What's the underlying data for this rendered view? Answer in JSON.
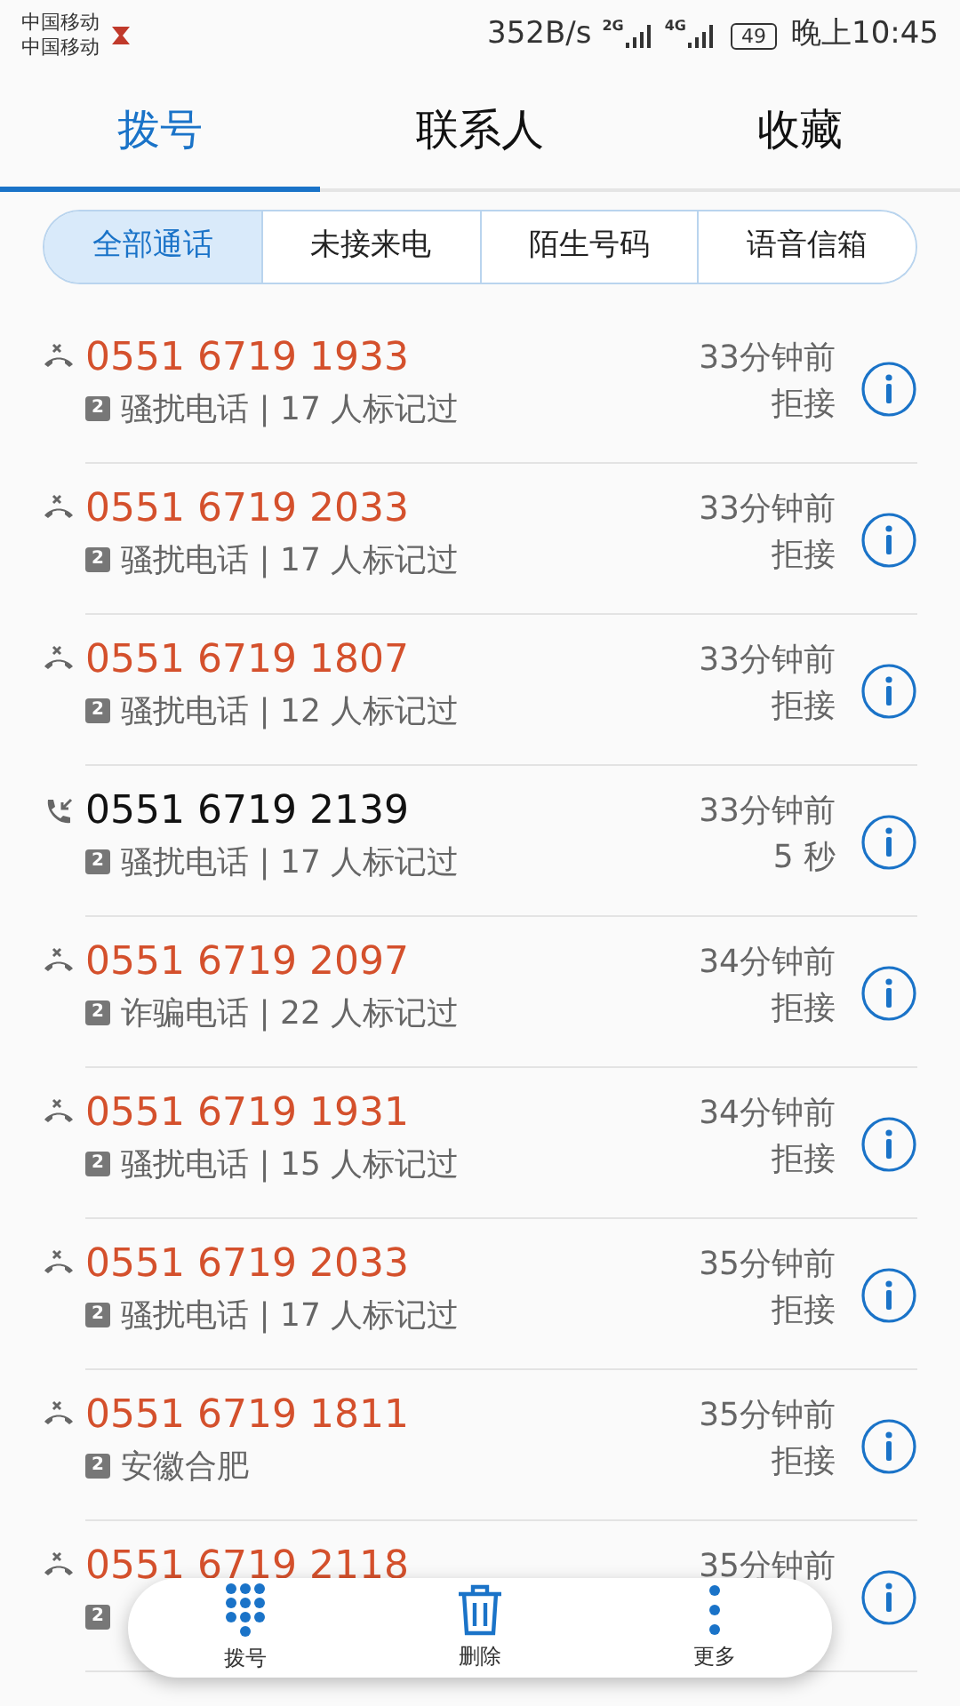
{
  "status_bar": {
    "carriers": [
      "中国移动",
      "中国移动"
    ],
    "speed": "352B/s",
    "networks": [
      "2G",
      "4G"
    ],
    "battery": "49",
    "time": "晚上10:45"
  },
  "tabs": [
    {
      "label": "拨号",
      "selected": true
    },
    {
      "label": "联系人",
      "selected": false
    },
    {
      "label": "收藏",
      "selected": false
    }
  ],
  "filters": [
    {
      "label": "全部通话",
      "selected": true
    },
    {
      "label": "未接来电",
      "selected": false
    },
    {
      "label": "陌生号码",
      "selected": false
    },
    {
      "label": "语音信箱",
      "selected": false
    }
  ],
  "calls": [
    {
      "kind": "rejected",
      "number": "0551 6719 1933",
      "sim": "2",
      "tag": "骚扰电话 | 17 人标记过",
      "time": "33分钟前",
      "status": "拒接"
    },
    {
      "kind": "rejected",
      "number": "0551 6719 2033",
      "sim": "2",
      "tag": "骚扰电话 | 17 人标记过",
      "time": "33分钟前",
      "status": "拒接"
    },
    {
      "kind": "rejected",
      "number": "0551 6719 1807",
      "sim": "2",
      "tag": "骚扰电话 | 12 人标记过",
      "time": "33分钟前",
      "status": "拒接"
    },
    {
      "kind": "incoming",
      "number": "0551 6719 2139",
      "sim": "2",
      "tag": "骚扰电话 | 17 人标记过",
      "time": "33分钟前",
      "status": "5 秒"
    },
    {
      "kind": "rejected",
      "number": "0551 6719 2097",
      "sim": "2",
      "tag": "诈骗电话 | 22 人标记过",
      "time": "34分钟前",
      "status": "拒接"
    },
    {
      "kind": "rejected",
      "number": "0551 6719 1931",
      "sim": "2",
      "tag": "骚扰电话 | 15 人标记过",
      "time": "34分钟前",
      "status": "拒接"
    },
    {
      "kind": "rejected",
      "number": "0551 6719 2033",
      "sim": "2",
      "tag": "骚扰电话 | 17 人标记过",
      "time": "35分钟前",
      "status": "拒接"
    },
    {
      "kind": "rejected",
      "number": "0551 6719 1811",
      "sim": "2",
      "tag": "安徽合肥",
      "time": "35分钟前",
      "status": "拒接"
    },
    {
      "kind": "rejected",
      "number": "0551 6719 2118",
      "sim": "2",
      "time": "35分钟前"
    }
  ],
  "bottom_bar": [
    {
      "kind": "dialpad",
      "label": "拨号"
    },
    {
      "kind": "delete",
      "label": "删除"
    },
    {
      "kind": "more",
      "label": "更多"
    }
  ]
}
